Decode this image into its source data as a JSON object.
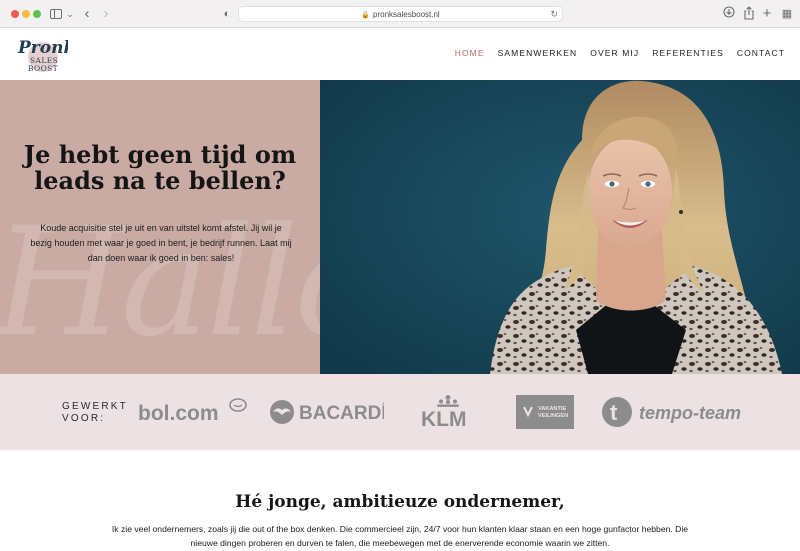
{
  "browser": {
    "url": "pronksalesboost.nl",
    "icons": [
      "sidebar-icon",
      "chevron-down-icon",
      "back-icon",
      "forward-icon",
      "shield-icon",
      "lock-icon",
      "reload-icon",
      "download-icon",
      "share-icon",
      "new-tab-icon",
      "tab-overview-icon"
    ]
  },
  "brand": {
    "logo_word": "Pronk",
    "logo_sub1": "SALES",
    "logo_sub2": "BOOST",
    "accent_color": "#b86a5e",
    "hero_bg": "#c9aba4",
    "strip_bg": "#ece2e3",
    "photo_bg": "#18475a"
  },
  "nav": {
    "items": [
      {
        "label": "HOME",
        "active": true
      },
      {
        "label": "SAMENWERKEN",
        "active": false
      },
      {
        "label": "OVER MIJ",
        "active": false
      },
      {
        "label": "REFERENTIES",
        "active": false
      },
      {
        "label": "CONTACT",
        "active": false
      }
    ]
  },
  "hero": {
    "watermark": "Hallo",
    "title": "Je hebt geen tijd om leads na te bellen?",
    "text": "Koude acquisitie stel je uit en van uitstel komt afstel. Jij wil je bezig houden met waar je goed in bent, je bedrijf runnen. Laat mij dan doen waar ik goed in ben: sales!"
  },
  "clients": {
    "label_line1": "GEWERKT",
    "label_line2": "VOOR:",
    "logos": [
      {
        "name": "bol.com",
        "text": "bol.com"
      },
      {
        "name": "bacardi",
        "text": "BACARDÍ"
      },
      {
        "name": "klm",
        "text": "KLM"
      },
      {
        "name": "vakantieveilingen",
        "text1": "VAKANTIE",
        "text2": "VEILINGEN"
      },
      {
        "name": "tempo-team",
        "text": "tempo-team"
      }
    ]
  },
  "intro": {
    "title": "Hé jonge, ambitieuze ondernemer,",
    "text": "Ik zie veel ondernemers, zoals jij die out of the box denken. Die commercieel zijn, 24/7 voor hun klanten klaar staan en een hoge gunfactor hebben. Die nieuwe dingen proberen en durven te falen, die meebewegen met de enerverende economie waarin we zitten."
  }
}
